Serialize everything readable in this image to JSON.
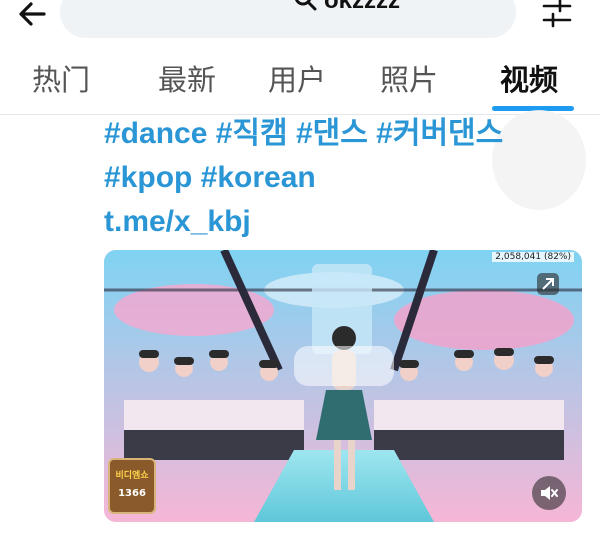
{
  "search": {
    "query": "okzzzz"
  },
  "tabs": [
    {
      "label": "热门"
    },
    {
      "label": "最新"
    },
    {
      "label": "用户"
    },
    {
      "label": "照片"
    },
    {
      "label": "视频"
    }
  ],
  "active_tab": "视频",
  "post": {
    "hashtag_lines": [
      "#dance #직캠 #댄스 #커버댄스",
      "#kpop #korean",
      "t.me/x_kbj"
    ]
  },
  "video": {
    "stats": "2,058,041 (82%)",
    "badge_text": "비디엠쇼",
    "badge_number": "1366"
  },
  "colors": {
    "accent": "#1d9bf0",
    "hashtag": "#2a96d6"
  },
  "icons": [
    "back-arrow-icon",
    "search-icon",
    "filter-sliders-icon",
    "mute-icon",
    "cast-icon"
  ]
}
